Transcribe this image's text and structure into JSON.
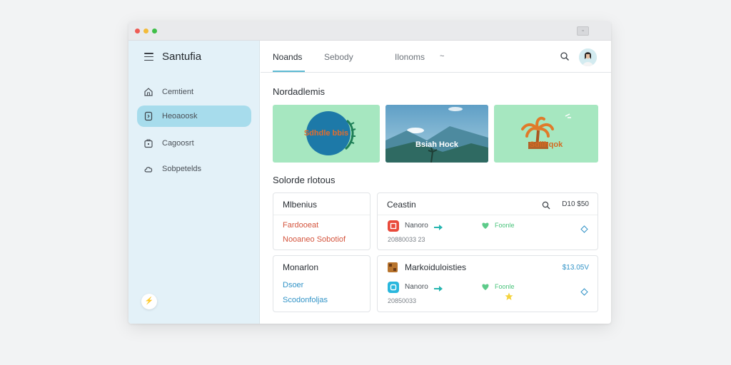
{
  "app": {
    "title": "Santufia"
  },
  "window": {
    "button_label": "▫"
  },
  "sidebar": {
    "items": [
      {
        "label": "Cemtient",
        "icon": "home-icon",
        "active": false
      },
      {
        "label": "Heoaoosk",
        "icon": "phone-icon",
        "active": true
      },
      {
        "label": "Cagoosrt",
        "icon": "briefcase-icon",
        "active": false
      },
      {
        "label": "Sobpetelds",
        "icon": "cloud-icon",
        "active": false
      }
    ],
    "bottom_button": "⚡"
  },
  "tabs": {
    "items": [
      "Noands",
      "Sebody",
      "Ilonoms"
    ],
    "active": "Noands",
    "chevron": "~"
  },
  "sections": {
    "featured_title": "Nordadlemis",
    "selected_title": "Solorde rlotous"
  },
  "featured_cards": [
    {
      "caption": "Sdhdle bbis",
      "bg": "#a6e7c0"
    },
    {
      "caption": "Bsiah Hock",
      "bg": "#6aa5c8"
    },
    {
      "caption": "Sdlihqok",
      "bg": "#a6e7c0"
    }
  ],
  "left_panels": [
    {
      "title": "Mlbenius",
      "links": [
        "Fardooeat",
        "Nooaneo Sobotiof"
      ],
      "link_color": "red"
    },
    {
      "title": "Monarlon",
      "links": [
        "Dsoer",
        "Scodonfoljas"
      ],
      "link_color": "blue"
    }
  ],
  "right_panels": [
    {
      "title": "Ceastin",
      "amount": "D10 $50",
      "row": {
        "name": "Nanoro",
        "status": "Foonle",
        "number": "20880033 23",
        "icon_color": "#e94a3b"
      }
    },
    {
      "title": "Markoiduloisties",
      "amount": "$13.05V",
      "row": {
        "name": "Nanoro",
        "status": "Foonle",
        "number": "20850033",
        "icon_color": "#29b7dd"
      }
    }
  ],
  "colors": {
    "accent": "#5dbad3",
    "sidebar_bg": "#e3f1f8",
    "active_item": "#a7dcec",
    "status_green": "#49c37b",
    "link_red": "#d4553e",
    "link_blue": "#3193c7"
  }
}
